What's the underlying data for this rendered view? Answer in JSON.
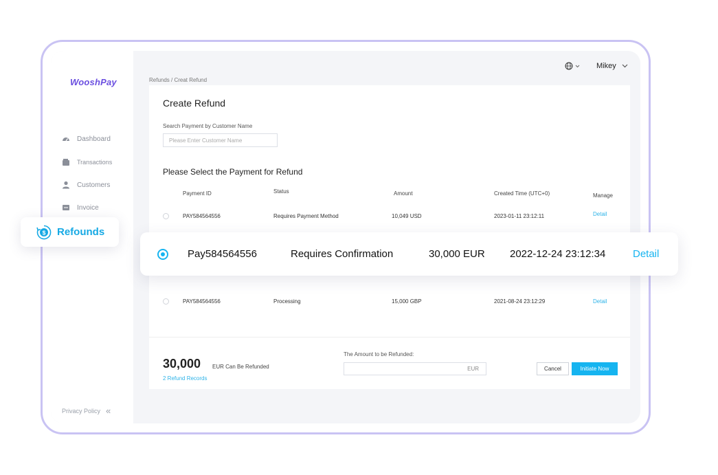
{
  "app": {
    "logo": "WooshPay"
  },
  "sidebar": {
    "items": [
      {
        "label": "Dashboard",
        "icon": "dashboard-icon"
      },
      {
        "label": "Transactions",
        "icon": "wallet-icon"
      },
      {
        "label": "Customers",
        "icon": "user-icon"
      },
      {
        "label": "Invoice",
        "icon": "invoice-icon"
      }
    ],
    "active_item": {
      "label": "Refounds",
      "icon": "refund-coin-icon"
    },
    "privacy_policy": "Privacy Policy"
  },
  "topbar": {
    "language_icon": "globe-icon",
    "user_name": "Mikey"
  },
  "breadcrumb": "Refunds / Creat Refund",
  "page": {
    "title": "Create Refund",
    "search": {
      "label": "Search Payment by Customer Name",
      "placeholder": "Please Enter Customer Name"
    },
    "section_title": "Please Select the Payment for Refund",
    "table": {
      "headers": [
        "Payment ID",
        "Status",
        "Amount",
        "Created Time (UTC+0)",
        "Manage"
      ],
      "rows": [
        {
          "id": "PAY584564556",
          "status": "Requires Payment Method",
          "amount": "10,049 USD",
          "created": "2023-01-11 23:12:11",
          "manage": "Detail"
        },
        {
          "id": "PAY584564556",
          "status": "Processing",
          "amount": "15,000 GBP",
          "created": "2021-08-24 23:12:29",
          "manage": "Detail"
        }
      ],
      "selected_row": {
        "id": "Pay584564556",
        "status": "Requires Confirmation",
        "amount": "30,000 EUR",
        "created": "2022-12-24 23:12:34",
        "manage": "Detail"
      }
    },
    "footer": {
      "amount": "30,000",
      "amount_note": "EUR Can Be Refunded",
      "records_link": "2 Refund Records",
      "amount_label": "The Amount to be Refunded:",
      "amount_currency": "EUR",
      "cancel": "Cancel",
      "initiate": "Initiate Now"
    }
  },
  "colors": {
    "brand": "#6b4fe0",
    "accent": "#16b4f0",
    "frame": "#c9c3f3"
  }
}
